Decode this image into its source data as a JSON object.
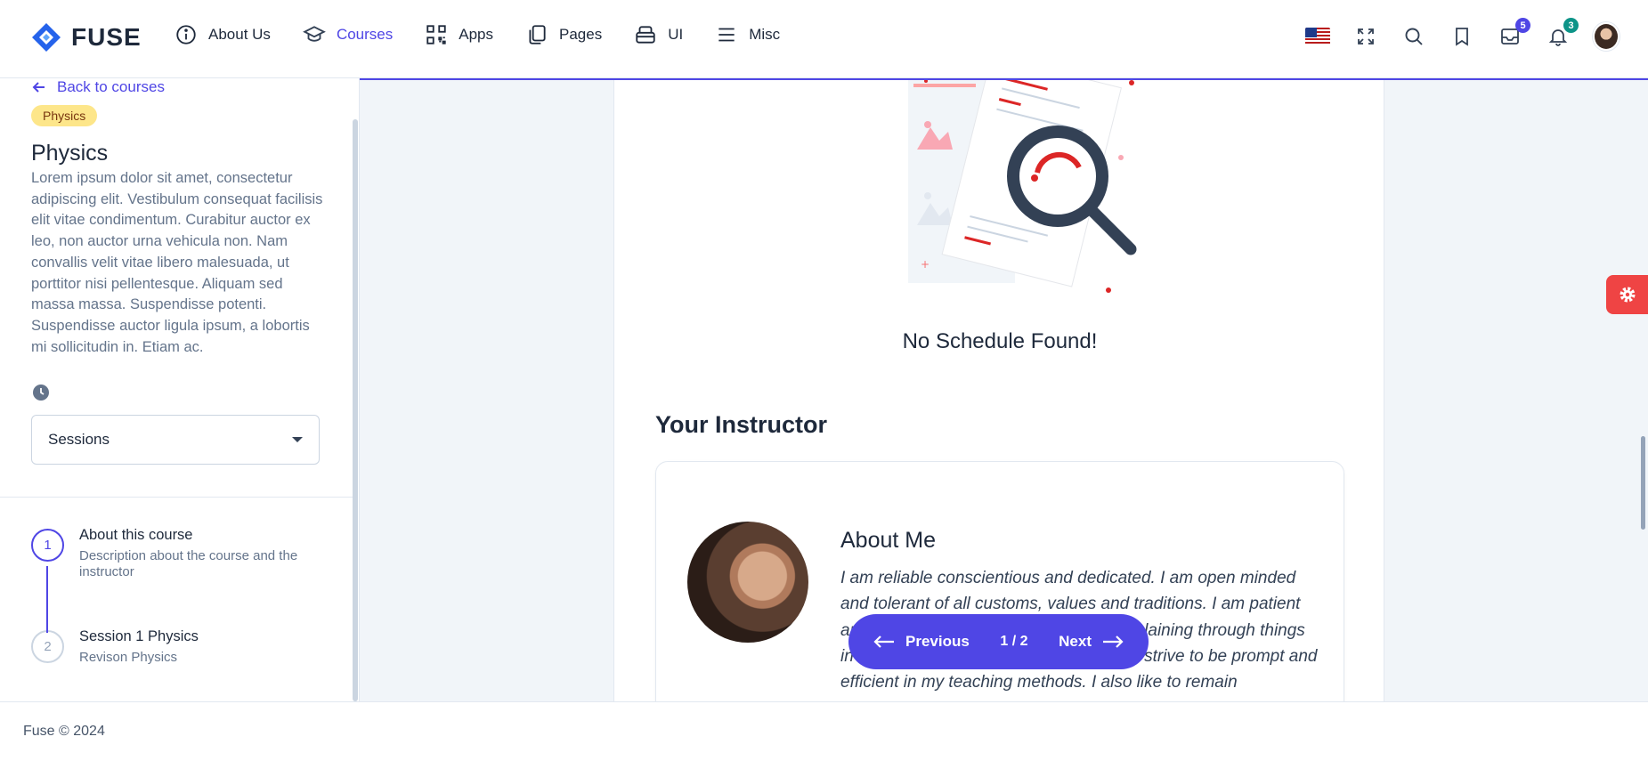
{
  "app": {
    "name": "FUSE"
  },
  "nav": {
    "items": [
      {
        "label": "About Us",
        "icon": "info-icon",
        "active": false
      },
      {
        "label": "Courses",
        "icon": "academic-cap-icon",
        "active": true
      },
      {
        "label": "Apps",
        "icon": "qrcode-icon",
        "active": false
      },
      {
        "label": "Pages",
        "icon": "document-duplicate-icon",
        "active": false
      },
      {
        "label": "UI",
        "icon": "archive-box-icon",
        "active": false
      },
      {
        "label": "Misc",
        "icon": "menu-icon",
        "active": false
      }
    ]
  },
  "top_actions": {
    "language_flag": "us-flag-icon",
    "messages_count": "5",
    "notifications_count": "3"
  },
  "drawer": {
    "back_label": "Back to courses",
    "category": "Physics",
    "title": "Physics",
    "description": "Lorem ipsum dolor sit amet, consectetur adipiscing elit. Vestibulum consequat facilisis elit vitae condimentum. Curabitur auctor ex leo, non auctor urna vehicula non. Nam convallis velit vitae libero malesuada, ut porttitor nisi pellentesque. Aliquam sed massa massa. Suspendisse potenti. Suspendisse auctor ligula ipsum, a lobortis mi sollicitudin in. Etiam ac.",
    "select_value": "Sessions",
    "steps": [
      {
        "number": "1",
        "title": "About this course",
        "subtitle": "Description about the course and the instructor",
        "active": true
      },
      {
        "number": "2",
        "title": "Session 1 Physics",
        "subtitle": "Revison Physics",
        "active": false
      }
    ]
  },
  "main": {
    "empty_state": "No Schedule Found!",
    "instructor_heading": "Your Instructor",
    "about_title": "About Me",
    "about_text": "I am reliable conscientious and dedicated. I am open minded and tolerant of all customs, values and traditions. I am patient and understanding when it comes to explaining through things in a way that students can understand. I strive to be prompt and efficient in my teaching methods. I also like to remain"
  },
  "pager": {
    "previous_label": "Previous",
    "next_label": "Next",
    "counter": "1 / 2"
  },
  "footer": {
    "text": "Fuse © 2024"
  },
  "colors": {
    "accent": "#4f46e5",
    "category_pill": "#fde68a",
    "settings_tab": "#ef4444",
    "illustration_red": "#dc2626"
  }
}
